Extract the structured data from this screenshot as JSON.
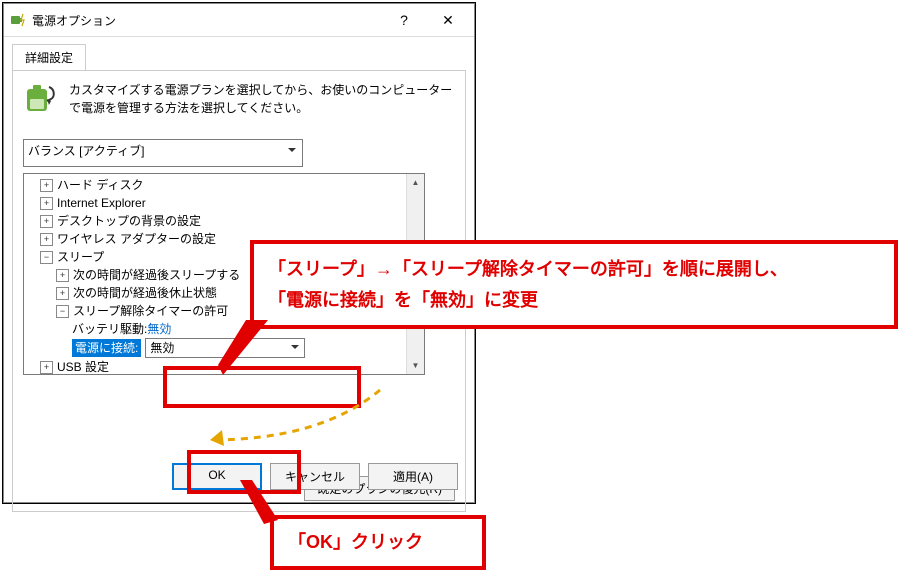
{
  "titlebar": {
    "title": "電源オプション",
    "help": "?",
    "close": "✕"
  },
  "tab": {
    "label": "詳細設定"
  },
  "description": "カスタマイズする電源プランを選択してから、お使いのコンピューターで電源を管理する方法を選択してください。",
  "plan_selected": "バランス [アクティブ]",
  "tree": {
    "hard_disk": "ハード ディスク",
    "ie": "Internet Explorer",
    "desktop_bg": "デスクトップの背景の設定",
    "wireless": "ワイヤレス アダプターの設定",
    "sleep": "スリープ",
    "sleep_after": "次の時間が経過後スリープする",
    "hibernate_after": "次の時間が経過後休止状態",
    "wake_timers": "スリープ解除タイマーの許可",
    "battery_label": "バッテリ駆動",
    "battery_value_link": "無効",
    "plugged_label": "電源に接続",
    "plugged_value": "無効",
    "usb": "USB 設定"
  },
  "restore_button": "既定のプランの復元(R)",
  "buttons": {
    "ok": "OK",
    "cancel": "キャンセル",
    "apply": "適用(A)"
  },
  "annotation1_line1": "「スリープ」→「スリープ解除タイマーの許可」を順に展開し、",
  "annotation1_line2": "「電源に接続」を「無効」に変更",
  "annotation2": "「OK」クリック"
}
